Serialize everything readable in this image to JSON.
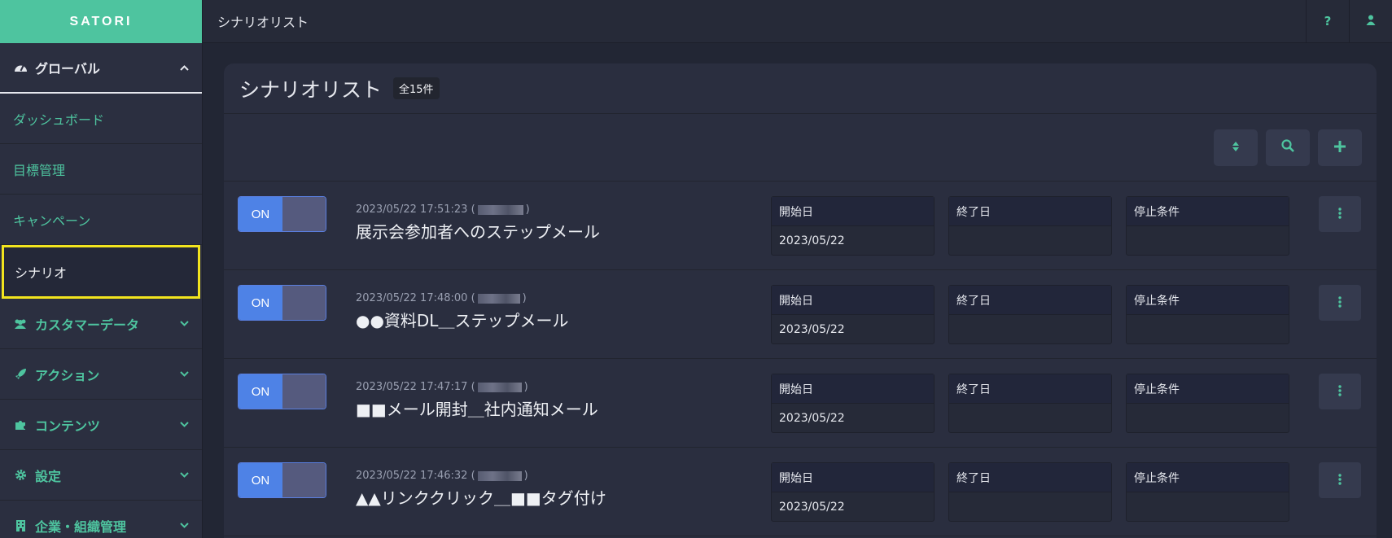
{
  "app": {
    "logo": "SATORI"
  },
  "header": {
    "title": "シナリオリスト",
    "help_icon": "question-icon",
    "user_icon": "user-icon"
  },
  "sidebar": {
    "sections": [
      {
        "label": "グローバル",
        "icon": "dashboard-gauge-icon",
        "expanded": true,
        "items": [
          {
            "label": "ダッシュボード"
          },
          {
            "label": "目標管理"
          },
          {
            "label": "キャンペーン"
          },
          {
            "label": "シナリオ",
            "active": true
          }
        ]
      },
      {
        "label": "カスタマーデータ",
        "icon": "users-icon"
      },
      {
        "label": "アクション",
        "icon": "rocket-icon"
      },
      {
        "label": "コンテンツ",
        "icon": "puzzle-icon"
      },
      {
        "label": "設定",
        "icon": "gear-icon"
      },
      {
        "label": "企業・組織管理",
        "icon": "building-icon"
      }
    ]
  },
  "main": {
    "title": "シナリオリスト",
    "count": "全15件",
    "toolbar": {
      "sort_icon": "sort-icon",
      "search_icon": "search-icon",
      "add_icon": "plus-icon"
    },
    "field_labels": {
      "start": "開始日",
      "end": "終了日",
      "stop": "停止条件"
    },
    "rows": [
      {
        "toggle": "ON",
        "timestamp": "2023/05/22 17:51:23 (",
        "close": ")",
        "name": "展示会参加者へのステップメール",
        "start": "2023/05/22",
        "end": "",
        "stop": ""
      },
      {
        "toggle": "ON",
        "timestamp": "2023/05/22 17:48:00 (",
        "close": ")",
        "name": "●●資料DL＿ステップメール",
        "start": "2023/05/22",
        "end": "",
        "stop": ""
      },
      {
        "toggle": "ON",
        "timestamp": "2023/05/22 17:47:17 (",
        "close": ")",
        "name": "■■メール開封＿社内通知メール",
        "start": "2023/05/22",
        "end": "",
        "stop": ""
      },
      {
        "toggle": "ON",
        "timestamp": "2023/05/22 17:46:32 (",
        "close": ")",
        "name": "▲▲リンククリック＿■■タグ付け",
        "start": "2023/05/22",
        "end": "",
        "stop": ""
      }
    ]
  },
  "colors": {
    "accent": "#4ec49f",
    "toggle_on": "#4e82e6",
    "highlight": "#f2e41e",
    "bg": "#222634"
  }
}
